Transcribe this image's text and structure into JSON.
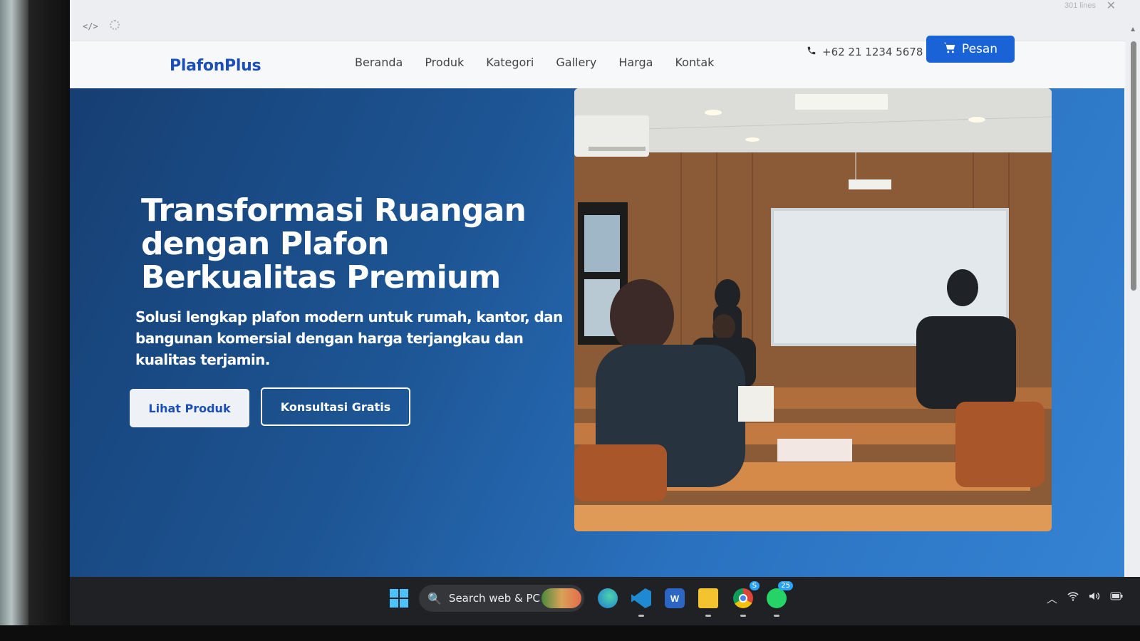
{
  "dev_bar": {
    "code_icon": "</>",
    "lines_count": "301 lines",
    "close_icon": "✕"
  },
  "navbar": {
    "brand": "PlafonPlus",
    "links": [
      "Beranda",
      "Produk",
      "Kategori",
      "Gallery",
      "Harga",
      "Kontak"
    ],
    "phone": "+62 21 1234 5678",
    "phone_icon": "📞",
    "order_button": "Pesan",
    "cart_icon": "🛒"
  },
  "hero": {
    "title": "Transformasi Ruangan dengan Plafon Berkualitas Premium",
    "subtitle": "Solusi lengkap plafon modern untuk rumah, kantor, dan bangunan komersial dengan harga terjangkau dan kualitas terjamin.",
    "primary_button": "Lihat Produk",
    "secondary_button": "Konsultasi Gratis",
    "image_icon": "classroom-photo"
  },
  "taskbar": {
    "search_label": "Search web & PC",
    "search_icon": "🔍",
    "apps": [
      "edge-icon",
      "vscode-icon",
      "word-icon",
      "file-explorer-icon",
      "chrome-icon",
      "whatsapp-icon"
    ],
    "chrome_badge": "S",
    "whatsapp_badge": "25",
    "tray_icons": [
      "^",
      "wifi",
      "speaker",
      "battery"
    ]
  },
  "colors": {
    "brand_blue": "#1d4fb8",
    "hero_start": "#163f73",
    "hero_end": "#3583d3",
    "order_button": "#1a63d6"
  }
}
